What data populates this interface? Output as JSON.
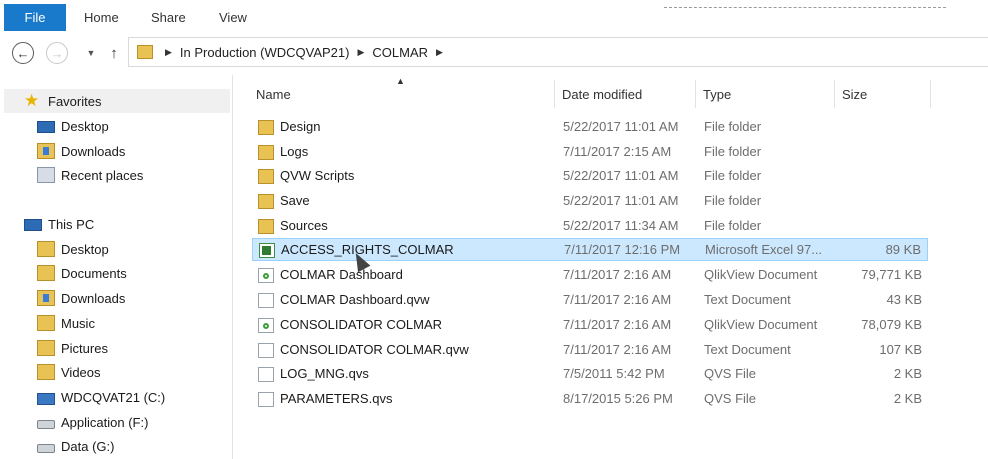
{
  "ribbon": {
    "tabs": [
      "File",
      "Home",
      "Share",
      "View"
    ]
  },
  "address_bar": {
    "back_icon": "back-arrow-icon",
    "forward_icon": "forward-arrow-icon",
    "recent_icon": "chevron-down-icon",
    "up_icon": "up-arrow-icon",
    "path": [
      "In Production (WDCQVAP21)",
      "COLMAR"
    ]
  },
  "nav_pane": {
    "favorites": {
      "label": "Favorites",
      "items": [
        "Desktop",
        "Downloads",
        "Recent places"
      ]
    },
    "this_pc": {
      "label": "This PC",
      "items": [
        "Desktop",
        "Documents",
        "Downloads",
        "Music",
        "Pictures",
        "Videos",
        "WDCQVAT21 (C:)",
        "Application (F:)",
        "Data (G:)"
      ]
    }
  },
  "columns": {
    "name": "Name",
    "date": "Date modified",
    "type": "Type",
    "size": "Size"
  },
  "files": [
    {
      "name": "Design",
      "date": "5/22/2017 11:01 AM",
      "type": "File folder",
      "size": "",
      "icon": "folder-icon"
    },
    {
      "name": "Logs",
      "date": "7/11/2017 2:15 AM",
      "type": "File folder",
      "size": "",
      "icon": "folder-icon"
    },
    {
      "name": "QVW Scripts",
      "date": "5/22/2017 11:01 AM",
      "type": "File folder",
      "size": "",
      "icon": "folder-icon"
    },
    {
      "name": "Save",
      "date": "5/22/2017 11:01 AM",
      "type": "File folder",
      "size": "",
      "icon": "folder-icon"
    },
    {
      "name": "Sources",
      "date": "5/22/2017 11:34 AM",
      "type": "File folder",
      "size": "",
      "icon": "folder-icon"
    },
    {
      "name": "ACCESS_RIGHTS_COLMAR",
      "date": "7/11/2017 12:16 PM",
      "type": "Microsoft Excel 97...",
      "size": "89 KB",
      "icon": "excel-file-icon",
      "selected": true
    },
    {
      "name": "COLMAR Dashboard",
      "date": "7/11/2017 2:16 AM",
      "type": "QlikView Document",
      "size": "79,771 KB",
      "icon": "qlikview-file-icon"
    },
    {
      "name": "COLMAR Dashboard.qvw",
      "date": "7/11/2017 2:16 AM",
      "type": "Text Document",
      "size": "43 KB",
      "icon": "text-file-icon"
    },
    {
      "name": "CONSOLIDATOR COLMAR",
      "date": "7/11/2017 2:16 AM",
      "type": "QlikView Document",
      "size": "78,079 KB",
      "icon": "qlikview-file-icon"
    },
    {
      "name": "CONSOLIDATOR COLMAR.qvw",
      "date": "7/11/2017 2:16 AM",
      "type": "Text Document",
      "size": "107 KB",
      "icon": "text-file-icon"
    },
    {
      "name": "LOG_MNG.qvs",
      "date": "7/5/2011 5:42 PM",
      "type": "QVS File",
      "size": "2 KB",
      "icon": "qvs-file-icon"
    },
    {
      "name": "PARAMETERS.qvs",
      "date": "8/17/2015 5:26 PM",
      "type": "QVS File",
      "size": "2 KB",
      "icon": "qvs-file-icon"
    }
  ]
}
